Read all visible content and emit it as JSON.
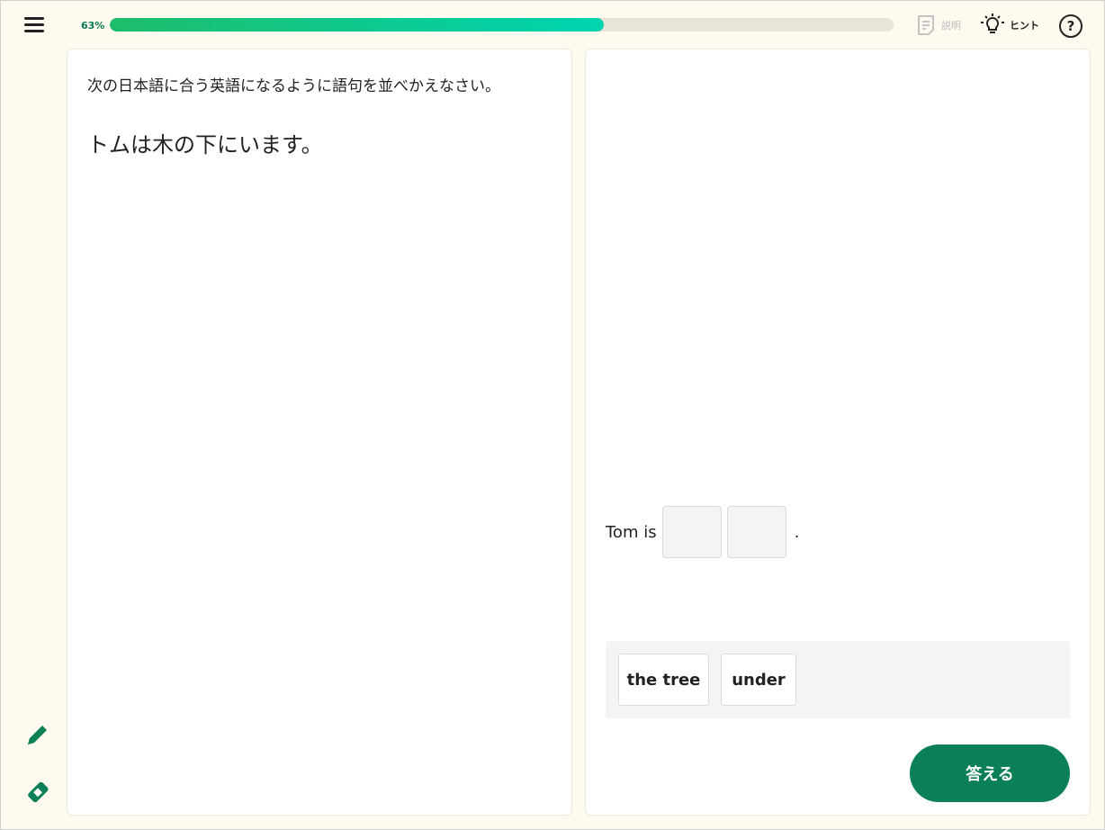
{
  "header": {
    "progress_label": "63%",
    "progress_value": 0.63,
    "description_label": "説明",
    "hint_label": "ヒント",
    "help_symbol": "?"
  },
  "left_panel": {
    "instruction": "次の日本語に合う英語になるように語句を並べかえなさい。",
    "question": "トムは木の下にいます。"
  },
  "right_panel": {
    "sentence_prefix": "Tom is",
    "sentence_suffix": ".",
    "word_bank": [
      "the tree",
      "under"
    ],
    "answer_label": "答える"
  },
  "icons": {
    "menu": "hamburger-menu-icon",
    "description": "document-icon",
    "hint": "lightbulb-icon",
    "help": "question-circle-icon",
    "pencil": "pencil-icon",
    "eraser": "eraser-icon"
  },
  "colors": {
    "accent": "#0b7f56",
    "progress_start": "#1dbd6a",
    "progress_end": "#00d4b0",
    "background": "#fefaef"
  }
}
